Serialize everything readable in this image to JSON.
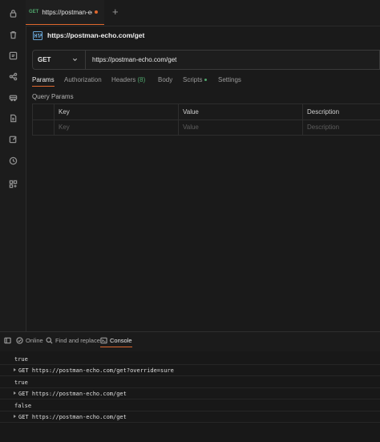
{
  "sidebar": {
    "icons": [
      "lock-icon",
      "trash-icon",
      "environment-icon",
      "flow-icon",
      "vehicle-icon",
      "document-icon",
      "edit-icon",
      "history-icon",
      "apps-icon"
    ]
  },
  "tab": {
    "method": "GET",
    "title": "https://postman-echo.c",
    "unsaved": true
  },
  "request": {
    "name": "https://postman-echo.com/get",
    "method": "GET",
    "url": "https://postman-echo.com/get"
  },
  "request_tabs": {
    "params": "Params",
    "authorization": "Authorization",
    "headers": "Headers",
    "headers_count": "(8)",
    "body": "Body",
    "scripts": "Scripts",
    "settings": "Settings"
  },
  "query_params": {
    "label": "Query Params",
    "headers": {
      "key": "Key",
      "value": "Value",
      "description": "Description"
    },
    "placeholders": {
      "key": "Key",
      "value": "Value",
      "description": "Description"
    }
  },
  "statusbar": {
    "online": "Online",
    "find_replace": "Find and replace",
    "console": "Console"
  },
  "console": {
    "lines": [
      {
        "kind": "log",
        "text": "true"
      },
      {
        "kind": "request",
        "text": "GET https://postman-echo.com/get?override=sure"
      },
      {
        "kind": "log",
        "text": "true"
      },
      {
        "kind": "request",
        "text": "GET https://postman-echo.com/get"
      },
      {
        "kind": "log",
        "text": "false"
      },
      {
        "kind": "request",
        "text": "GET https://postman-echo.com/get"
      }
    ]
  },
  "colors": {
    "accent": "#e0682e",
    "get_method": "#4fa66c",
    "background": "#1a1a1a"
  }
}
